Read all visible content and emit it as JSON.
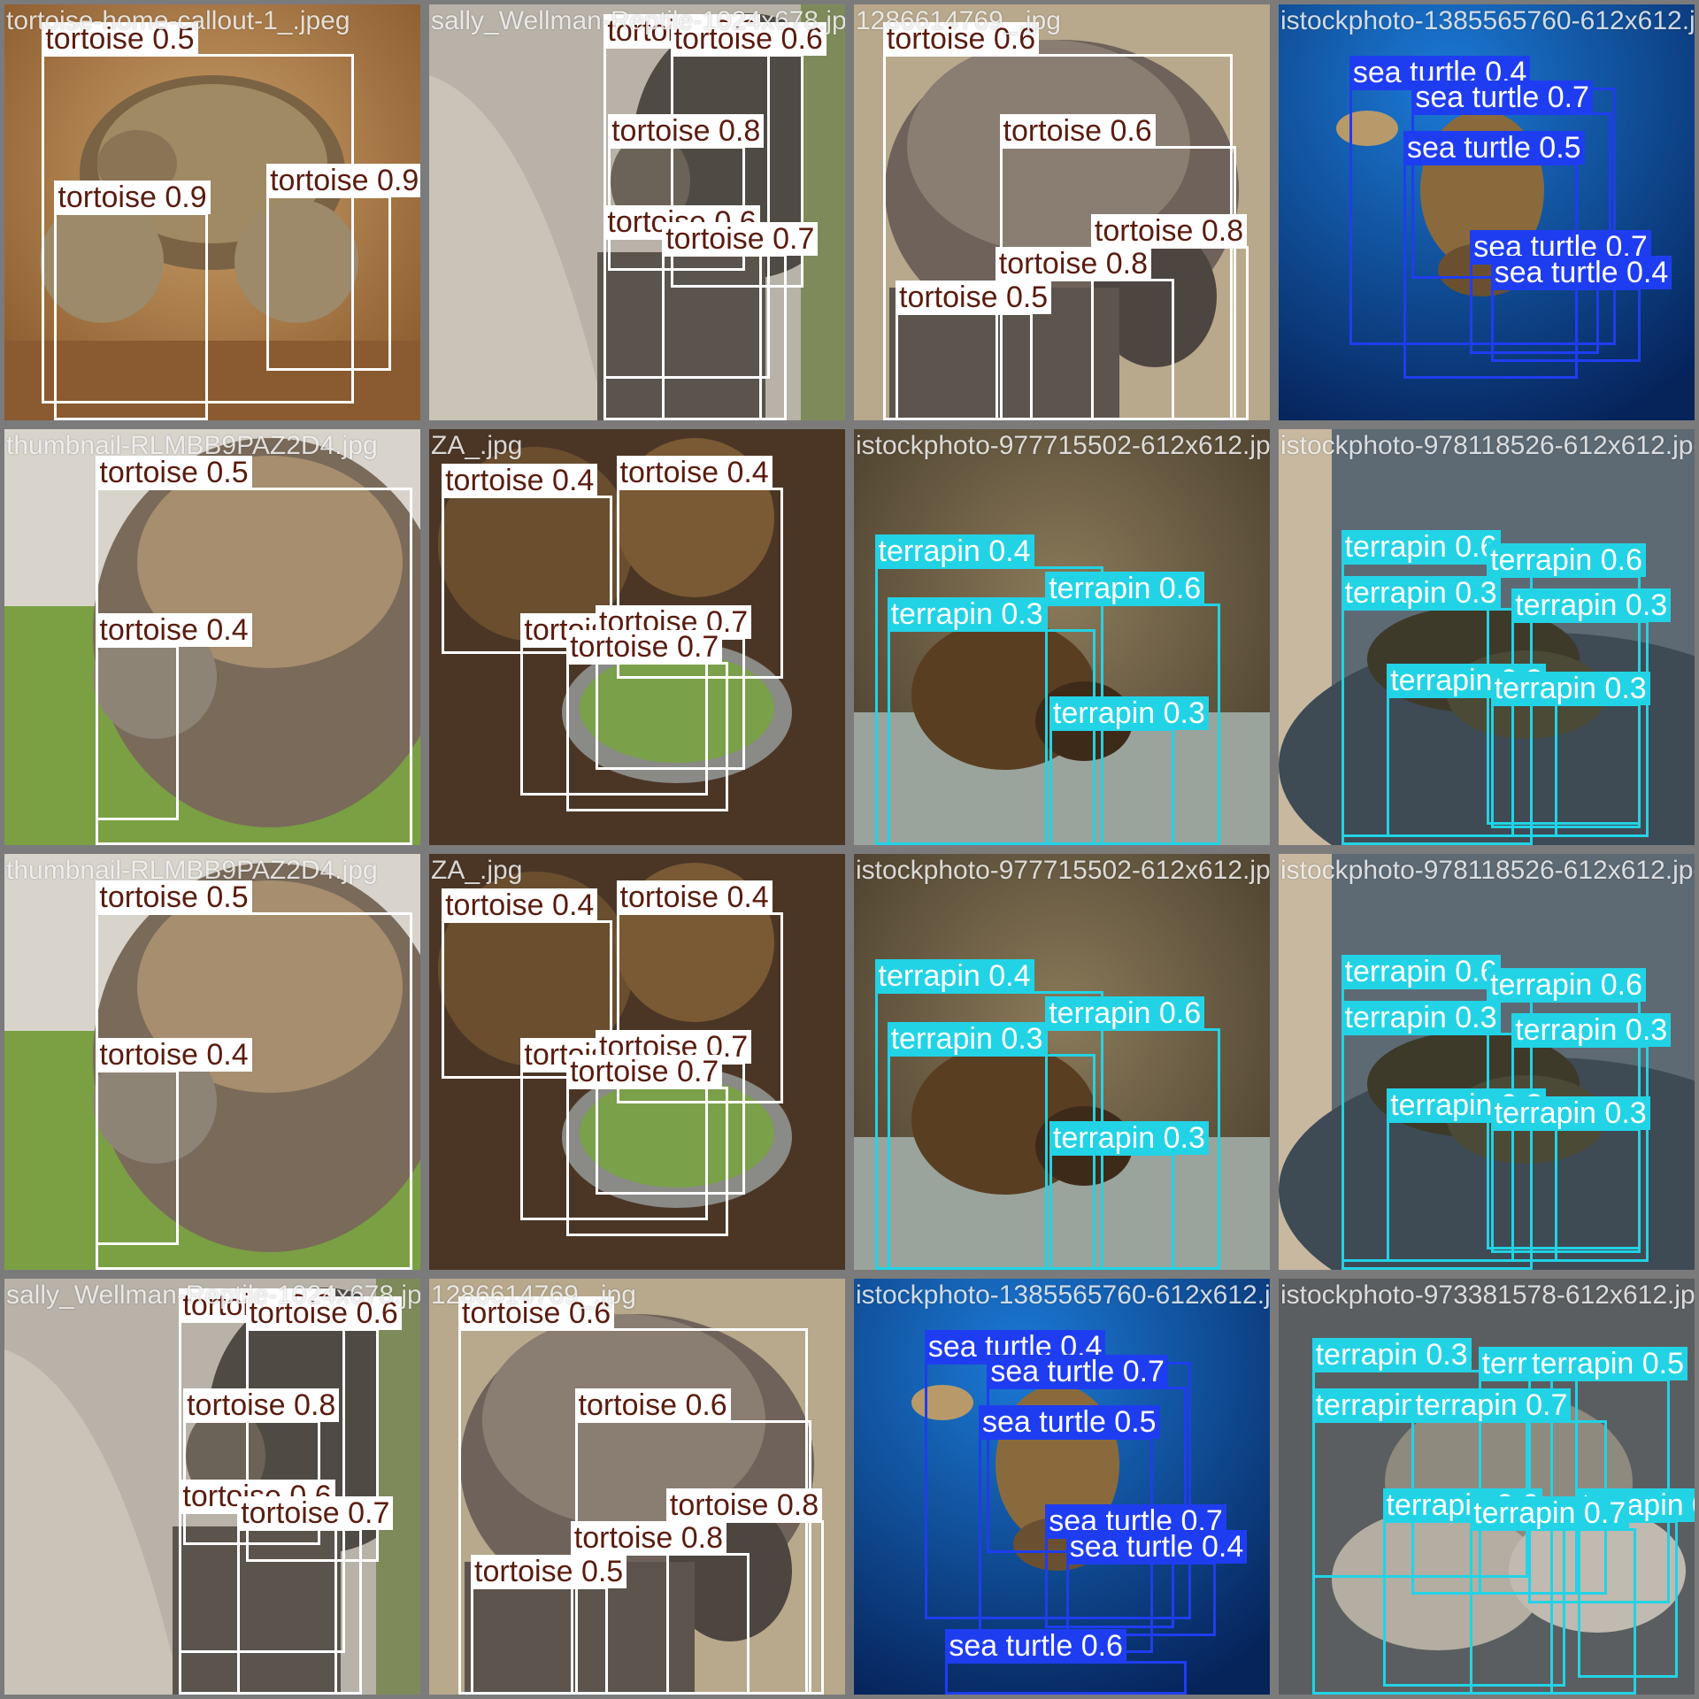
{
  "class_colors": {
    "tortoise": {
      "box": "#ffffff",
      "text": "#5a1c0f"
    },
    "sea turtle": {
      "box": "#1f3df0",
      "text": "#ffffff"
    },
    "terrapin": {
      "box": "#22d3e6",
      "text": "#ffffff"
    }
  },
  "tiles": [
    {
      "file": "tortoise-home-callout-1_.jpeg",
      "scene": "sandy",
      "dets": [
        {
          "cls": "tortoise",
          "label": "tortoise 0.5"
        },
        {
          "cls": "tortoise",
          "label": "tortoise 0.9"
        },
        {
          "cls": "tortoise",
          "label": "tortoise 0.9"
        }
      ]
    },
    {
      "file": "sally_Wellman-Reptile-1024x678.jpg",
      "scene": "path",
      "dets": [
        {
          "cls": "tortoise",
          "label": "tortoise 0.6"
        },
        {
          "cls": "tortoise",
          "label": "tortoise 0.6"
        },
        {
          "cls": "tortoise",
          "label": "tortoise 0.8"
        },
        {
          "cls": "tortoise",
          "label": "tortoise 0.6"
        },
        {
          "cls": "tortoise",
          "label": "tortoise 0.7"
        }
      ]
    },
    {
      "file": "1286614769_.jpg",
      "scene": "dirt",
      "dets": [
        {
          "cls": "tortoise",
          "label": "tortoise 0.6"
        },
        {
          "cls": "tortoise",
          "label": "tortoise 0.6"
        },
        {
          "cls": "tortoise",
          "label": "tortoise 0.8"
        },
        {
          "cls": "tortoise",
          "label": "tortoise 0.8"
        },
        {
          "cls": "tortoise",
          "label": "tortoise 0.5"
        }
      ]
    },
    {
      "file": "istockphoto-1385565760-612x612.jpg",
      "scene": "ocean",
      "dets": [
        {
          "cls": "sea-turtle",
          "label": "sea turtle 0.4"
        },
        {
          "cls": "sea-turtle",
          "label": "sea turtle 0.7"
        },
        {
          "cls": "sea-turtle",
          "label": "sea turtle 0.5"
        },
        {
          "cls": "sea-turtle",
          "label": "sea turtle 0.7"
        },
        {
          "cls": "sea-turtle",
          "label": "sea turtle 0.4"
        }
      ]
    },
    {
      "file": "thumbnail-RLMBB9PAZ2D4.jpg",
      "scene": "grass",
      "dets": [
        {
          "cls": "tortoise",
          "label": "tortoise 0.5"
        },
        {
          "cls": "tortoise",
          "label": "tortoise 0.4"
        }
      ]
    },
    {
      "file": "ZA_.jpg",
      "scene": "soil",
      "dets": [
        {
          "cls": "tortoise",
          "label": "tortoise 0.4"
        },
        {
          "cls": "tortoise",
          "label": "tortoise 0.4"
        },
        {
          "cls": "tortoise",
          "label": "tortoise 0.7"
        },
        {
          "cls": "tortoise",
          "label": "tortoise 0.7"
        },
        {
          "cls": "tortoise",
          "label": "tortoise 0.7"
        }
      ]
    },
    {
      "file": "istockphoto-977715502-612x612.jpg",
      "scene": "rock",
      "dets": [
        {
          "cls": "terrapin",
          "label": "terrapin 0.4"
        },
        {
          "cls": "terrapin",
          "label": "terrapin 0.6"
        },
        {
          "cls": "terrapin",
          "label": "terrapin 0.3"
        },
        {
          "cls": "terrapin",
          "label": "terrapin 0.3"
        }
      ]
    },
    {
      "file": "istockphoto-978118526-612x612.jpg",
      "scene": "log",
      "dets": [
        {
          "cls": "terrapin",
          "label": "terrapin 0.6"
        },
        {
          "cls": "terrapin",
          "label": "terrapin 0.6"
        },
        {
          "cls": "terrapin",
          "label": "terrapin 0.3"
        },
        {
          "cls": "terrapin",
          "label": "terrapin 0.3"
        },
        {
          "cls": "terrapin",
          "label": "terrapin 0.3"
        },
        {
          "cls": "terrapin",
          "label": "terrapin 0.3"
        }
      ]
    },
    {
      "file": "thumbnail-RLMBB9PAZ2D4.jpg",
      "scene": "grass",
      "dets": [
        {
          "cls": "tortoise",
          "label": "tortoise 0.5"
        },
        {
          "cls": "tortoise",
          "label": "tortoise 0.4"
        }
      ]
    },
    {
      "file": "ZA_.jpg",
      "scene": "soil",
      "dets": [
        {
          "cls": "tortoise",
          "label": "tortoise 0.4"
        },
        {
          "cls": "tortoise",
          "label": "tortoise 0.4"
        },
        {
          "cls": "tortoise",
          "label": "tortoise 0.7"
        },
        {
          "cls": "tortoise",
          "label": "tortoise 0.7"
        },
        {
          "cls": "tortoise",
          "label": "tortoise 0.7"
        }
      ]
    },
    {
      "file": "istockphoto-977715502-612x612.jpg",
      "scene": "rock",
      "dets": [
        {
          "cls": "terrapin",
          "label": "terrapin 0.4"
        },
        {
          "cls": "terrapin",
          "label": "terrapin 0.6"
        },
        {
          "cls": "terrapin",
          "label": "terrapin 0.3"
        },
        {
          "cls": "terrapin",
          "label": "terrapin 0.3"
        }
      ]
    },
    {
      "file": "istockphoto-978118526-612x612.jpg",
      "scene": "log",
      "dets": [
        {
          "cls": "terrapin",
          "label": "terrapin 0.6"
        },
        {
          "cls": "terrapin",
          "label": "terrapin 0.6"
        },
        {
          "cls": "terrapin",
          "label": "terrapin 0.3"
        },
        {
          "cls": "terrapin",
          "label": "terrapin 0.3"
        },
        {
          "cls": "terrapin",
          "label": "terrapin 0.3"
        },
        {
          "cls": "terrapin",
          "label": "terrapin 0.3"
        }
      ]
    },
    {
      "file": "sally_Wellman-Reptile-1024x678.jpg",
      "scene": "path",
      "dets": [
        {
          "cls": "tortoise",
          "label": "tortoise 0.6"
        },
        {
          "cls": "tortoise",
          "label": "tortoise 0.6"
        },
        {
          "cls": "tortoise",
          "label": "tortoise 0.8"
        },
        {
          "cls": "tortoise",
          "label": "tortoise 0.6"
        },
        {
          "cls": "tortoise",
          "label": "tortoise 0.7"
        }
      ]
    },
    {
      "file": "1286614769_.jpg",
      "scene": "dirt",
      "dets": [
        {
          "cls": "tortoise",
          "label": "tortoise 0.6"
        },
        {
          "cls": "tortoise",
          "label": "tortoise 0.6"
        },
        {
          "cls": "tortoise",
          "label": "tortoise 0.8"
        },
        {
          "cls": "tortoise",
          "label": "tortoise 0.8"
        },
        {
          "cls": "tortoise",
          "label": "tortoise 0.5"
        }
      ]
    },
    {
      "file": "istockphoto-1385565760-612x612.jpg",
      "scene": "ocean",
      "dets": [
        {
          "cls": "sea-turtle",
          "label": "sea turtle 0.4"
        },
        {
          "cls": "sea-turtle",
          "label": "sea turtle 0.7"
        },
        {
          "cls": "sea-turtle",
          "label": "sea turtle 0.5"
        },
        {
          "cls": "sea-turtle",
          "label": "sea turtle 0.7"
        },
        {
          "cls": "sea-turtle",
          "label": "sea turtle 0.4"
        },
        {
          "cls": "sea-turtle",
          "label": "sea turtle 0.6"
        }
      ]
    },
    {
      "file": "istockphoto-973381578-612x612.jpg",
      "scene": "pond",
      "dets": [
        {
          "cls": "terrapin",
          "label": "terrapin 0.3"
        },
        {
          "cls": "terrapin",
          "label": "terrapin 0.4"
        },
        {
          "cls": "terrapin",
          "label": "terrapin 0.5"
        },
        {
          "cls": "terrapin",
          "label": "terrapin 0.4"
        },
        {
          "cls": "terrapin",
          "label": "terrapin 0.7"
        },
        {
          "cls": "terrapin",
          "label": "terrapin 0.6"
        },
        {
          "cls": "terrapin",
          "label": "terrapin 0.6"
        },
        {
          "cls": "terrapin",
          "label": "terrapin 0.7"
        }
      ]
    }
  ]
}
